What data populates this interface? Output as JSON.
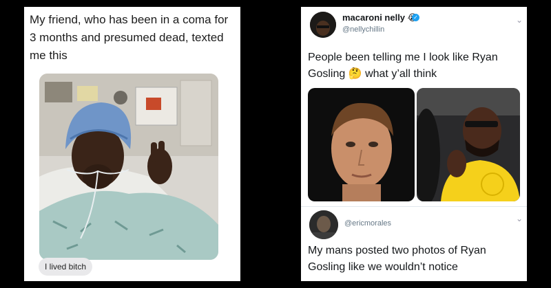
{
  "left_meme": {
    "caption": "My friend, who has been in a coma for 3 months and presumed dead, texted me this",
    "message": "I lived bitch"
  },
  "right_meme": {
    "tweet": {
      "author_name": "macaroni nelly",
      "author_emoji": "😭",
      "author_handle": "@nellychillin",
      "text_part1": "People been telling me I look like Ryan Gosling",
      "text_emoji": "🤔",
      "text_part2": "what y’all think"
    },
    "reply": {
      "author_handle": "@ericmorales",
      "text": "My mans posted two photos of Ryan Gosling like we wouldn’t notice"
    }
  },
  "icons": [
    "verified-badge-icon",
    "chevron-down-icon"
  ],
  "colors": {
    "background": "#000000",
    "panel": "#ffffff",
    "handle": "#657786",
    "verified": "#1da1f2"
  }
}
